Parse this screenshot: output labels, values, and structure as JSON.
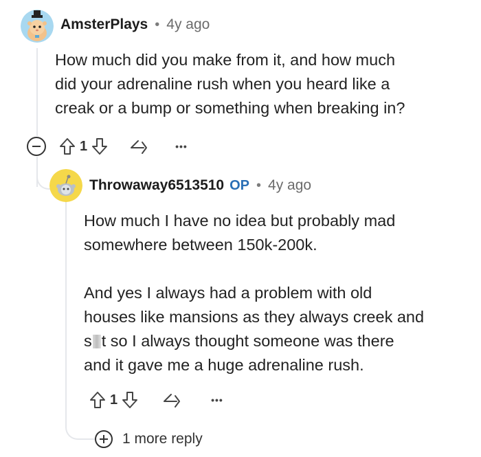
{
  "parent_comment": {
    "username": "AmsterPlays",
    "separator": "•",
    "timestamp": "4y ago",
    "body_lines": [
      "How much did you make from it, and how much",
      "did your adrenaline rush when you heard like a",
      "creak or a bump or something when breaking in?"
    ],
    "vote_count": "1",
    "more_label": "•••"
  },
  "reply_comment": {
    "username": "Throwaway6513510",
    "op_badge": "OP",
    "separator": "•",
    "timestamp": "4y ago",
    "paragraph1_lines": [
      "How much I have no idea but probably mad",
      "somewhere between 150k-200k."
    ],
    "paragraph2_lines": [
      "And yes I always had a problem with old",
      "houses like mansions as they always creek and"
    ],
    "censored_line_start": "s",
    "censored_line_end": "t so I always thought someone was there",
    "paragraph2_last_line": "and it gave me a huge adrenaline rush.",
    "vote_count": "1",
    "more_label": "•••"
  },
  "more_replies": {
    "label": "1 more reply"
  },
  "colors": {
    "op_badge": "#2a6fb6",
    "thread_line": "#e5e7eb",
    "avatar_bg_parent": "#a8d8f0",
    "avatar_bg_reply": "#f5d84a"
  },
  "icons": {
    "upvote": "arrow-up-outline",
    "downvote": "arrow-down-outline",
    "share": "share-arrow",
    "more": "ellipsis",
    "collapse": "minus-circle",
    "expand": "plus-circle"
  }
}
